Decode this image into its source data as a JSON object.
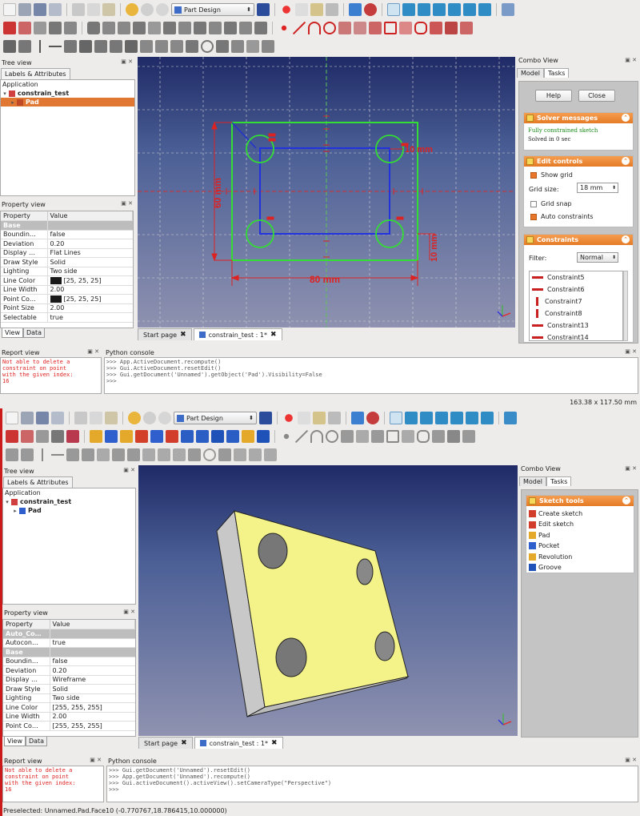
{
  "workbench": "Part Design",
  "tree": {
    "title": "Tree view",
    "tab": "Labels & Attributes",
    "root": "Application",
    "document": "constrain_test",
    "item": "Pad"
  },
  "property_view": {
    "title": "Property view",
    "col_property": "Property",
    "col_value": "Value",
    "tabs": [
      "View",
      "Data"
    ]
  },
  "props_top": [
    {
      "k": "Base",
      "v": "",
      "group": true
    },
    {
      "k": "Boundin…",
      "v": "false"
    },
    {
      "k": "Deviation",
      "v": "0.20"
    },
    {
      "k": "Display …",
      "v": "Flat Lines"
    },
    {
      "k": "Draw Style",
      "v": "Solid"
    },
    {
      "k": "Lighting",
      "v": "Two side"
    },
    {
      "k": "Line Color",
      "v": "[25, 25, 25]",
      "swatch": "#191919"
    },
    {
      "k": "Line Width",
      "v": "2.00"
    },
    {
      "k": "Point Co…",
      "v": "[25, 25, 25]",
      "swatch": "#191919"
    },
    {
      "k": "Point Size",
      "v": "2.00"
    },
    {
      "k": "Selectable",
      "v": "true"
    }
  ],
  "props_bottom": [
    {
      "k": "Auto_Co…",
      "v": "",
      "group": true
    },
    {
      "k": "Autocon…",
      "v": "true"
    },
    {
      "k": "Base",
      "v": "",
      "group": true
    },
    {
      "k": "Boundin…",
      "v": "false"
    },
    {
      "k": "Deviation",
      "v": "0.20"
    },
    {
      "k": "Display …",
      "v": "Wireframe"
    },
    {
      "k": "Draw Style",
      "v": "Solid"
    },
    {
      "k": "Lighting",
      "v": "Two side"
    },
    {
      "k": "Line Color",
      "v": "[255, 255, 255]"
    },
    {
      "k": "Line Width",
      "v": "2.00"
    },
    {
      "k": "Point Co…",
      "v": "[255, 255, 255]"
    }
  ],
  "doc_tabs": {
    "start": "Start page",
    "doc": "constrain_test : 1*"
  },
  "combo": {
    "title": "Combo View",
    "tab_model": "Model",
    "tab_tasks": "Tasks",
    "help": "Help",
    "close": "Close",
    "solver_title": "Solver messages",
    "solver_status": "Fully constrained sketch",
    "solver_time": "Solved in 0 sec",
    "edit_title": "Edit controls",
    "show_grid": "Show grid",
    "grid_size_label": "Grid size:",
    "grid_size": "18 mm",
    "grid_snap": "Grid snap",
    "auto_constraints": "Auto constraints",
    "constraints_title": "Constraints",
    "filter_label": "Filter:",
    "filter_value": "Normal",
    "constraints": [
      "Constraint5",
      "Constraint6",
      "Constraint7",
      "Constraint8",
      "Constraint13",
      "Constraint14"
    ],
    "sketch_tools_title": "Sketch tools",
    "sketch_tools": [
      "Create sketch",
      "Edit sketch",
      "Pad",
      "Pocket",
      "Revolution",
      "Groove"
    ]
  },
  "sketch": {
    "dim_width": "80 mm",
    "dim_height": "60 mm",
    "dim_right": "10 mm",
    "dim_bottom": "10 mm"
  },
  "report": {
    "title": "Report view",
    "lines": [
      "Not able to delete a",
      "constraint on point",
      "with the given index:",
      "16"
    ]
  },
  "python": {
    "title": "Python console",
    "top_lines": [
      ">>> App.ActiveDocument.recompute()",
      ">>> Gui.ActiveDocument.resetEdit()",
      ">>> Gui.getDocument('Unnamed').getObject('Pad').Visibility=False",
      ">>>"
    ],
    "bottom_lines": [
      ">>> Gui.getDocument('Unnamed').resetEdit()",
      ">>> App.getDocument('Unnamed').recompute()",
      ">>> Gui.activeDocument().activeView().setCameraType(\"Perspective\")",
      ">>>"
    ]
  },
  "status": {
    "top": "163.38 x 117.50 mm",
    "bottom": "Preselected: Unnamed.Pad.Face10 (-0.770767,18.786415,10.000000)"
  }
}
